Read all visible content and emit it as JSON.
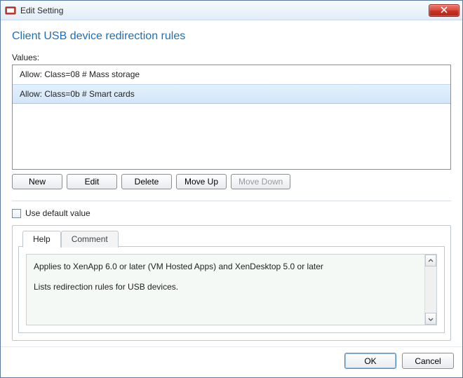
{
  "window": {
    "title": "Edit Setting"
  },
  "heading": "Client USB device redirection rules",
  "values": {
    "label": "Values:",
    "items": [
      {
        "text": "Allow: Class=08 # Mass storage",
        "selected": false
      },
      {
        "text": "Allow: Class=0b # Smart cards",
        "selected": true
      }
    ]
  },
  "buttons": {
    "new": "New",
    "edit": "Edit",
    "delete": "Delete",
    "move_up": "Move Up",
    "move_down": "Move Down",
    "move_down_disabled": true
  },
  "default_checkbox": {
    "label": "Use default value",
    "checked": false
  },
  "tabs": {
    "help": "Help",
    "comment": "Comment",
    "active": "help"
  },
  "help": {
    "line1": "Applies to XenApp 6.0 or later (VM Hosted Apps) and XenDesktop 5.0 or later",
    "line2": "Lists redirection rules for USB devices."
  },
  "footer": {
    "ok": "OK",
    "cancel": "Cancel"
  }
}
